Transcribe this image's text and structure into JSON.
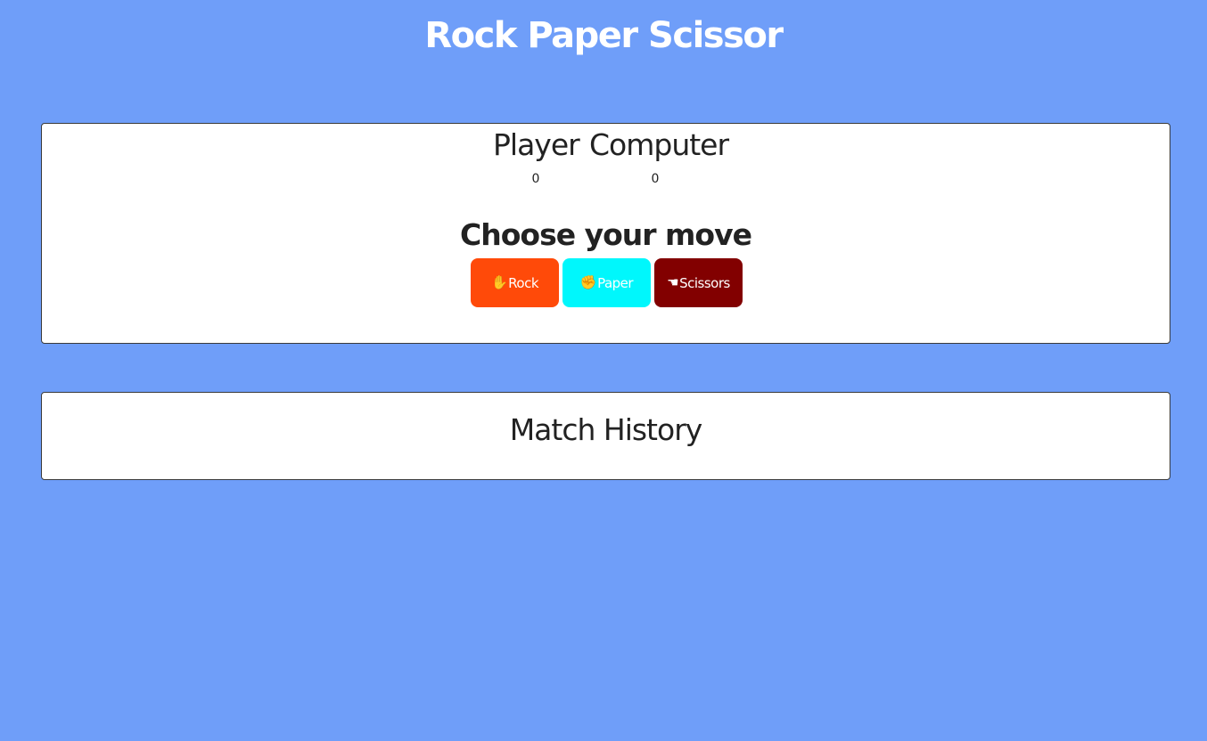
{
  "page": {
    "title": "Rock Paper Scissor",
    "background_color": "#6f9ef9"
  },
  "scoreboard": {
    "player_label": "Player",
    "player_score": "0",
    "computer_label": "Computer",
    "computer_score": "0"
  },
  "moves": {
    "heading": "Choose your move",
    "buttons": [
      {
        "label": "Rock",
        "icon": "hand-icon",
        "color": "#ff4a09"
      },
      {
        "label": "Paper",
        "icon": "fist-icon",
        "color": "#00f7fc"
      },
      {
        "label": "Scissors",
        "icon": "pointing-hand-icon",
        "color": "#820000"
      }
    ]
  },
  "history": {
    "heading": "Match History"
  }
}
